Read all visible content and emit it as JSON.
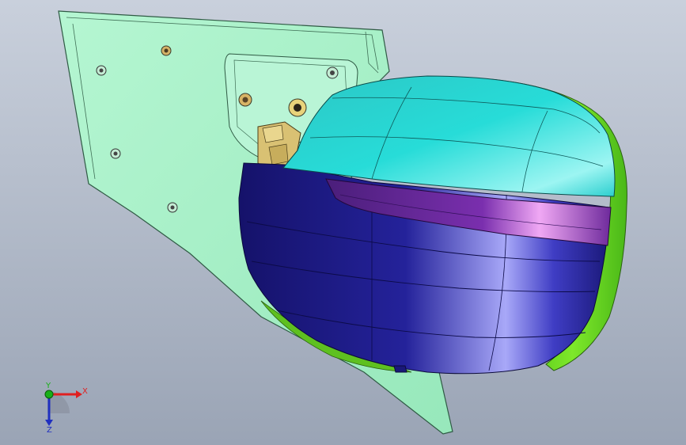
{
  "viewport": {
    "background_top": "#c9d0dc",
    "background_bottom": "#9aa4b5"
  },
  "model": {
    "bracket_color": "#a8f2c8",
    "bracket_edge": "#2f5a44",
    "cover_top_color": "#29dcd6",
    "housing_color": "#1c1a86",
    "housing_highlight": "#a8a8f8",
    "signal_strip_color": "#6e2a9c",
    "signal_highlight": "#f0a8f4",
    "glass_rim_color": "#6de020",
    "actuator_color": "#d9c173"
  },
  "triad": {
    "x_label": "X",
    "y_label": "Y",
    "z_label": "Z",
    "x_color": "#e02020",
    "y_color": "#18b018",
    "z_color": "#2030c0"
  }
}
